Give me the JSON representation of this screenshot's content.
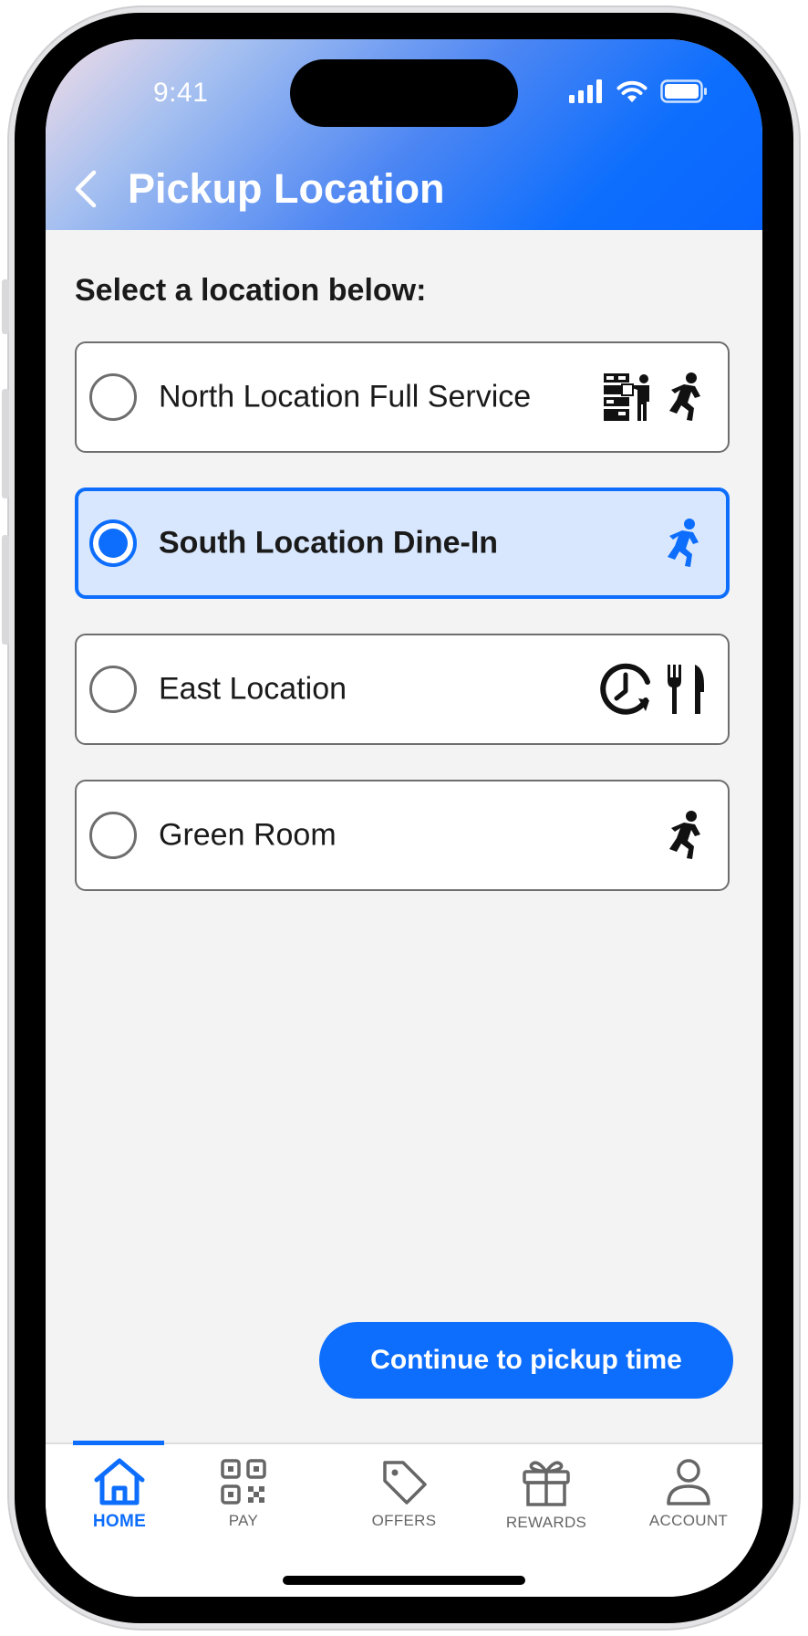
{
  "status_bar": {
    "time": "9:41"
  },
  "header": {
    "title": "Pickup Location"
  },
  "main": {
    "subtitle": "Select a location below:",
    "locations": [
      {
        "label": "North Location Full Service",
        "selected": false,
        "icons": [
          "locker-pickup-icon",
          "running-person-icon"
        ]
      },
      {
        "label": "South Location Dine-In",
        "selected": true,
        "icons": [
          "running-person-icon"
        ]
      },
      {
        "label": "East Location",
        "selected": false,
        "icons": [
          "clock-icon",
          "fork-knife-icon"
        ]
      },
      {
        "label": "Green Room",
        "selected": false,
        "icons": [
          "running-person-icon"
        ]
      }
    ],
    "continue_label": "Continue to pickup time"
  },
  "tabbar": {
    "items": [
      {
        "label": "HOME",
        "icon": "home-icon",
        "active": true
      },
      {
        "label": "PAY",
        "icon": "qr-code-icon",
        "active": false
      },
      {
        "label": "OFFERS",
        "icon": "tag-icon",
        "active": false
      },
      {
        "label": "REWARDS",
        "icon": "gift-icon",
        "active": false
      },
      {
        "label": "ACCOUNT",
        "icon": "user-icon",
        "active": false
      }
    ]
  },
  "colors": {
    "accent": "#0d6efd",
    "selected_bg": "#d8e7fd",
    "screen_bg": "#f3f3f3"
  }
}
